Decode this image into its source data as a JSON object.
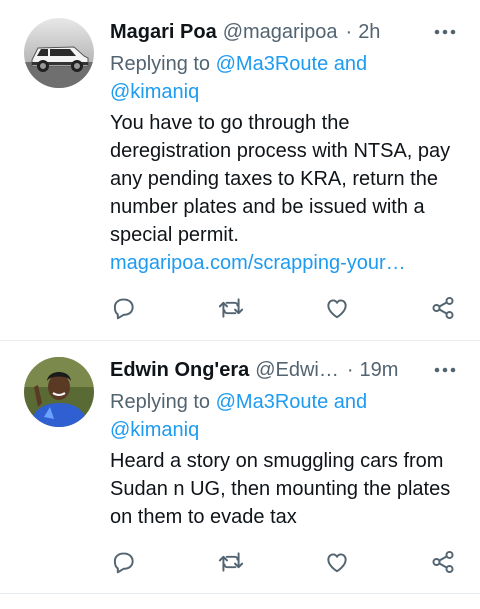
{
  "tweets": [
    {
      "author_name": "Magari Poa",
      "author_handle": "@magaripoa",
      "separator": "·",
      "time": "2h",
      "replying_prefix": "Replying to",
      "replying_mentions": "@Ma3Route and",
      "replying_mentions_2": "@kimaniq",
      "body": "You have to go through the deregistration process with NTSA, pay any pending taxes to KRA, return the number plates and be issued with a special permit.",
      "link": "magaripoa.com/scrapping-your…",
      "avatar_icon": "white-suv-photo",
      "colors": {
        "name": "#0f1419",
        "meta": "#536471",
        "accent": "#1d9bf0"
      }
    },
    {
      "author_name": "Edwin Ong'era",
      "author_handle": "@Edwi…",
      "separator": "·",
      "time": "19m",
      "replying_prefix": "Replying to",
      "replying_mentions": "@Ma3Route and",
      "replying_mentions_2": "@kimaniq",
      "body": "Heard a story on smuggling cars from Sudan n UG, then mounting the plates on them to evade tax",
      "avatar_icon": "person-photo"
    }
  ],
  "action_icons": [
    "reply-icon",
    "retweet-icon",
    "like-icon",
    "share-icon"
  ],
  "more_icon": "more-options-icon"
}
